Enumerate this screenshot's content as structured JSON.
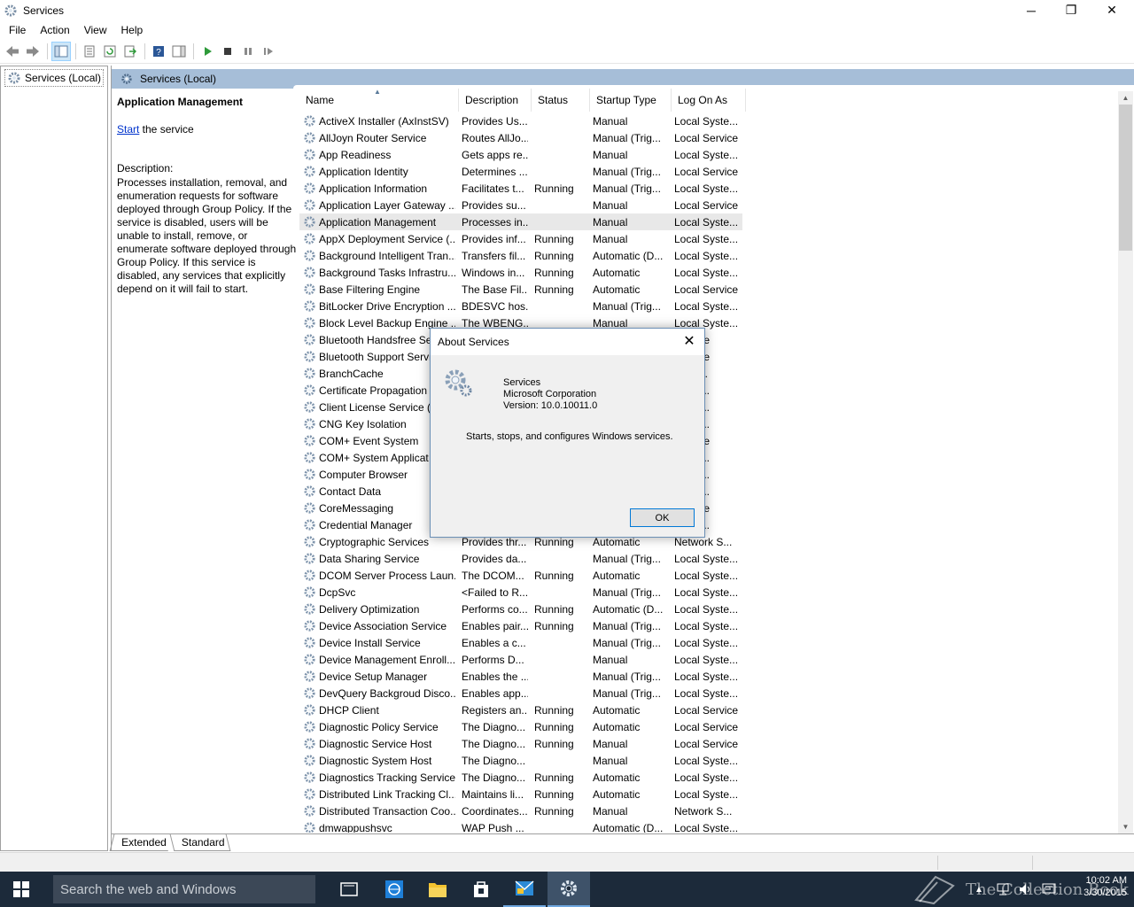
{
  "window": {
    "title": "Services",
    "minimize_label": "─",
    "maximize_label": "❐",
    "close_label": "✕"
  },
  "menu": [
    "File",
    "Action",
    "View",
    "Help"
  ],
  "tree": {
    "root_label": "Services (Local)"
  },
  "main": {
    "header_label": "Services (Local)",
    "details": {
      "title": "Application Management",
      "start_link": "Start",
      "start_suffix": " the service",
      "description_label": "Description:",
      "description_text": "Processes installation, removal, and enumeration requests for software deployed through Group Policy. If the service is disabled, users will be unable to install, remove, or enumerate software deployed through Group Policy. If this service is disabled, any services that explicitly depend on it will fail to start."
    },
    "columns": [
      "Name",
      "Description",
      "Status",
      "Startup Type",
      "Log On As"
    ],
    "selected_row": 6,
    "rows": [
      [
        "ActiveX Installer (AxInstSV)",
        "Provides Us...",
        "",
        "Manual",
        "Local Syste..."
      ],
      [
        "AllJoyn Router Service",
        "Routes AllJo...",
        "",
        "Manual (Trig...",
        "Local Service"
      ],
      [
        "App Readiness",
        "Gets apps re...",
        "",
        "Manual",
        "Local Syste..."
      ],
      [
        "Application Identity",
        "Determines ...",
        "",
        "Manual (Trig...",
        "Local Service"
      ],
      [
        "Application Information",
        "Facilitates t...",
        "Running",
        "Manual (Trig...",
        "Local Syste..."
      ],
      [
        "Application Layer Gateway ...",
        "Provides su...",
        "",
        "Manual",
        "Local Service"
      ],
      [
        "Application Management",
        "Processes in...",
        "",
        "Manual",
        "Local Syste..."
      ],
      [
        "AppX Deployment Service (...",
        "Provides inf...",
        "Running",
        "Manual",
        "Local Syste..."
      ],
      [
        "Background Intelligent Tran...",
        "Transfers fil...",
        "Running",
        "Automatic (D...",
        "Local Syste..."
      ],
      [
        "Background Tasks Infrastru...",
        "Windows in...",
        "Running",
        "Automatic",
        "Local Syste..."
      ],
      [
        "Base Filtering Engine",
        "The Base Fil...",
        "Running",
        "Automatic",
        "Local Service"
      ],
      [
        "BitLocker Drive Encryption ...",
        "BDESVC hos...",
        "",
        "Manual (Trig...",
        "Local Syste..."
      ],
      [
        "Block Level Backup Engine ...",
        "The WBENG...",
        "",
        "Manual",
        "Local Syste..."
      ],
      [
        "Bluetooth Handsfree Se",
        "",
        "",
        "",
        "Service"
      ],
      [
        "Bluetooth Support Servi",
        "",
        "",
        "",
        "Service"
      ],
      [
        "BranchCache",
        "",
        "",
        "",
        "ork S..."
      ],
      [
        "Certificate Propagation",
        "",
        "",
        "",
        "Syste..."
      ],
      [
        "Client License Service (C",
        "",
        "",
        "",
        "Syste..."
      ],
      [
        "CNG Key Isolation",
        "",
        "",
        "",
        "Syste..."
      ],
      [
        "COM+ Event System",
        "",
        "",
        "",
        "Service"
      ],
      [
        "COM+ System Applicat",
        "",
        "",
        "",
        "Syste..."
      ],
      [
        "Computer Browser",
        "",
        "",
        "",
        "Syste..."
      ],
      [
        "Contact Data",
        "",
        "",
        "",
        "Syste..."
      ],
      [
        "CoreMessaging",
        "",
        "",
        "",
        "Service"
      ],
      [
        "Credential Manager",
        "",
        "",
        "",
        "Syste..."
      ],
      [
        "Cryptographic Services",
        "Provides thr...",
        "Running",
        "Automatic",
        "Network S..."
      ],
      [
        "Data Sharing Service",
        "Provides da...",
        "",
        "Manual (Trig...",
        "Local Syste..."
      ],
      [
        "DCOM Server Process Laun...",
        "The DCOM...",
        "Running",
        "Automatic",
        "Local Syste..."
      ],
      [
        "DcpSvc",
        "<Failed to R...",
        "",
        "Manual (Trig...",
        "Local Syste..."
      ],
      [
        "Delivery Optimization",
        "Performs co...",
        "Running",
        "Automatic (D...",
        "Local Syste..."
      ],
      [
        "Device Association Service",
        "Enables pair...",
        "Running",
        "Manual (Trig...",
        "Local Syste..."
      ],
      [
        "Device Install Service",
        "Enables a c...",
        "",
        "Manual (Trig...",
        "Local Syste..."
      ],
      [
        "Device Management Enroll...",
        "Performs D...",
        "",
        "Manual",
        "Local Syste..."
      ],
      [
        "Device Setup Manager",
        "Enables the ...",
        "",
        "Manual (Trig...",
        "Local Syste..."
      ],
      [
        "DevQuery Backgroud Disco...",
        "Enables app...",
        "",
        "Manual (Trig...",
        "Local Syste..."
      ],
      [
        "DHCP Client",
        "Registers an...",
        "Running",
        "Automatic",
        "Local Service"
      ],
      [
        "Diagnostic Policy Service",
        "The Diagno...",
        "Running",
        "Automatic",
        "Local Service"
      ],
      [
        "Diagnostic Service Host",
        "The Diagno...",
        "Running",
        "Manual",
        "Local Service"
      ],
      [
        "Diagnostic System Host",
        "The Diagno...",
        "",
        "Manual",
        "Local Syste..."
      ],
      [
        "Diagnostics Tracking Service",
        "The Diagno...",
        "Running",
        "Automatic",
        "Local Syste..."
      ],
      [
        "Distributed Link Tracking Cl...",
        "Maintains li...",
        "Running",
        "Automatic",
        "Local Syste..."
      ],
      [
        "Distributed Transaction Coo...",
        "Coordinates...",
        "Running",
        "Manual",
        "Network S..."
      ],
      [
        "dmwappushsvc",
        "WAP Push ...",
        "",
        "Automatic (D...",
        "Local Syste..."
      ]
    ]
  },
  "tabs": {
    "extended": "Extended",
    "standard": "Standard"
  },
  "dialog": {
    "title": "About Services",
    "close_label": "✕",
    "product": "Services",
    "company": "Microsoft Corporation",
    "version": "Version: 10.0.10011.0",
    "description": "Starts, stops, and configures Windows services.",
    "ok_label": "OK"
  },
  "taskbar": {
    "search_placeholder": "Search the web and Windows",
    "time": "10:02 AM",
    "date": "3/30/2015"
  },
  "watermark": "The Collection Book",
  "colors": {
    "accent": "#0078d7",
    "header_band": "#a6bed8",
    "taskbar": "#1c2a3a",
    "link": "#0033cc"
  }
}
